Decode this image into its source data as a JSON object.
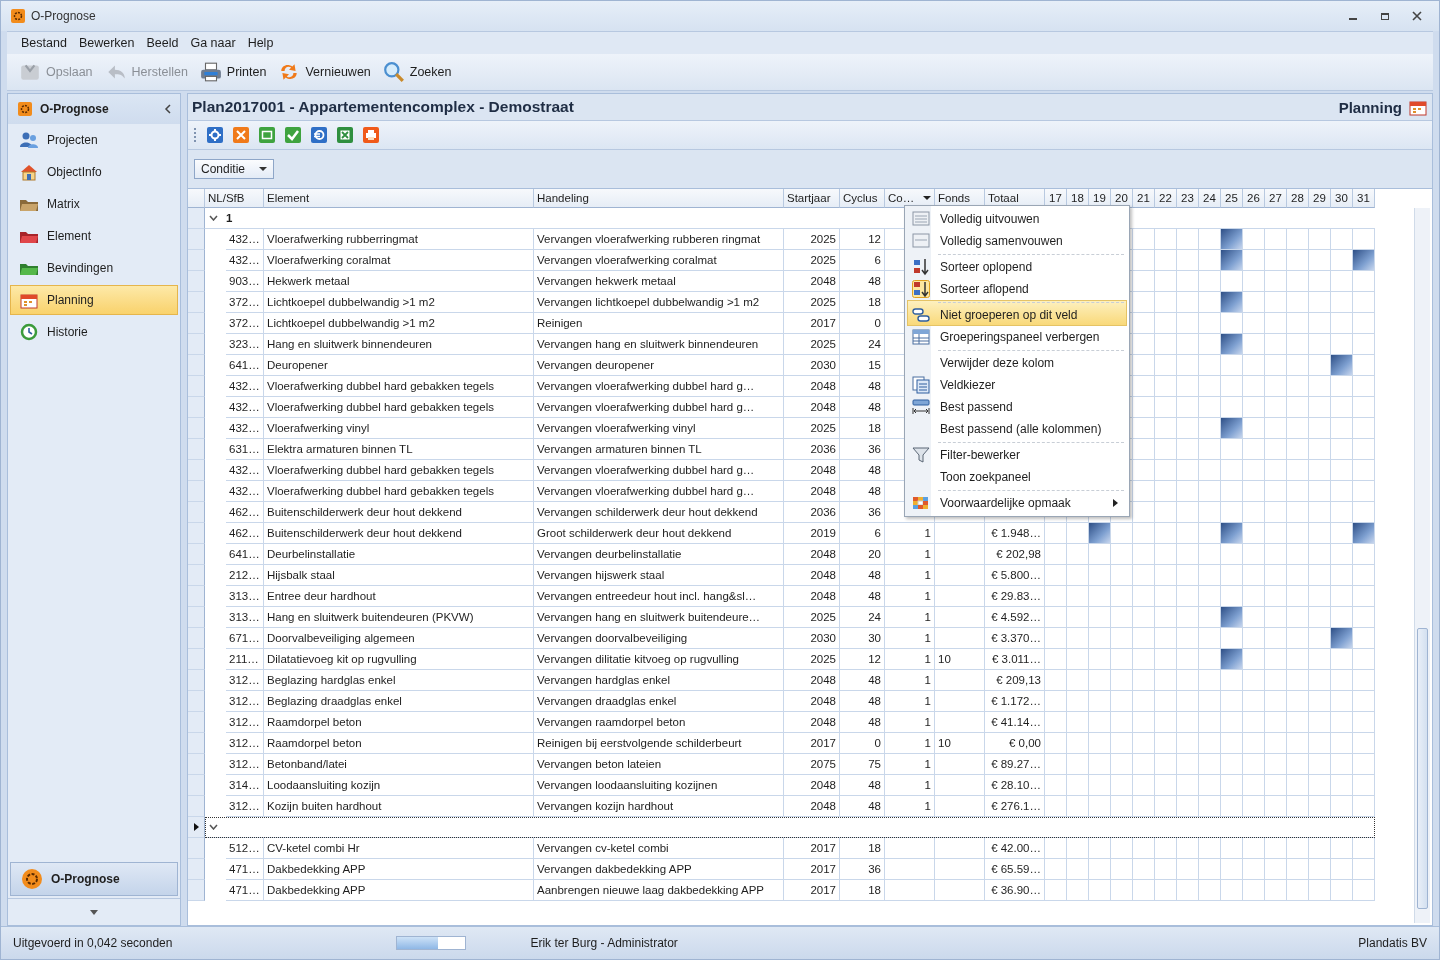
{
  "window": {
    "title": "O-Prognose"
  },
  "menu": [
    "Bestand",
    "Bewerken",
    "Beeld",
    "Ga naar",
    "Help"
  ],
  "toolbar": [
    {
      "label": "Opslaan",
      "disabled": true
    },
    {
      "label": "Herstellen",
      "disabled": true
    },
    {
      "label": "Printen",
      "disabled": false
    },
    {
      "label": "Vernieuwen",
      "disabled": false
    },
    {
      "label": "Zoeken",
      "disabled": false
    }
  ],
  "sidebar": {
    "title": "O-Prognose",
    "items": [
      {
        "label": "Projecten",
        "selected": false
      },
      {
        "label": "ObjectInfo",
        "selected": false
      },
      {
        "label": "Matrix",
        "selected": false
      },
      {
        "label": "Element",
        "selected": false
      },
      {
        "label": "Bevindingen",
        "selected": false
      },
      {
        "label": "Planning",
        "selected": true
      },
      {
        "label": "Historie",
        "selected": false
      }
    ],
    "footer": "O-Prognose"
  },
  "content": {
    "title": "Plan2017001 - Appartementencomplex - Demostraat",
    "section": "Planning"
  },
  "group_panel": {
    "field": "Conditie"
  },
  "table": {
    "columns": [
      "NL/SfB",
      "Element",
      "Handeling",
      "Startjaar",
      "Cyclus",
      "Co…",
      "Fonds",
      "Totaal"
    ],
    "timeline_columns": [
      "17",
      "18",
      "19",
      "20",
      "21",
      "22",
      "23",
      "24",
      "25",
      "26",
      "27",
      "28",
      "29",
      "30",
      "31"
    ],
    "groups": [
      {
        "label": "1",
        "expanded": true,
        "current": false,
        "rows": [
          {
            "code": "432…",
            "element": "Vloerafwerking rubberringmat",
            "action": "Vervangen vloerafwerking rubberen ringmat",
            "start": "2025",
            "cycle": "12",
            "timeline": [
              false,
              false,
              false,
              false,
              true,
              false,
              false,
              false,
              false,
              false,
              false
            ]
          },
          {
            "code": "432…",
            "element": "Vloerafwerking coralmat",
            "action": "Vervangen vloerafwerking coralmat",
            "start": "2025",
            "cycle": "6",
            "timeline": [
              false,
              false,
              false,
              false,
              true,
              false,
              false,
              false,
              false,
              false,
              true
            ]
          },
          {
            "code": "903…",
            "element": "Hekwerk metaal",
            "action": "Vervangen hekwerk metaal",
            "start": "2048",
            "cycle": "48",
            "timeline": [
              false,
              false,
              false,
              false,
              false,
              false,
              false,
              false,
              false,
              false,
              false
            ]
          },
          {
            "code": "372…",
            "element": "Lichtkoepel dubbelwandig >1 m2",
            "action": "Vervangen lichtkoepel dubbelwandig >1 m2",
            "start": "2025",
            "cycle": "18",
            "timeline": [
              false,
              false,
              false,
              false,
              true,
              false,
              false,
              false,
              false,
              false,
              false
            ]
          },
          {
            "code": "372…",
            "element": "Lichtkoepel dubbelwandig >1 m2",
            "action": "Reinigen",
            "start": "2017",
            "cycle": "0",
            "timeline": [
              false,
              false,
              false,
              false,
              false,
              false,
              false,
              false,
              false,
              false,
              false
            ]
          },
          {
            "code": "323…",
            "element": "Hang en sluitwerk binnendeuren",
            "action": "Vervangen hang en sluitwerk binnendeuren",
            "start": "2025",
            "cycle": "24",
            "timeline": [
              false,
              false,
              false,
              false,
              true,
              false,
              false,
              false,
              false,
              false,
              false
            ]
          },
          {
            "code": "641…",
            "element": "Deuropener",
            "action": "Vervangen deuropener",
            "start": "2030",
            "cycle": "15",
            "timeline": [
              false,
              false,
              false,
              false,
              false,
              false,
              false,
              false,
              false,
              true,
              false
            ]
          },
          {
            "code": "432…",
            "element": "Vloerafwerking dubbel hard gebakken tegels",
            "action": "Vervangen vloerafwerking dubbel hard g…",
            "start": "2048",
            "cycle": "48",
            "timeline": [
              false,
              false,
              false,
              false,
              false,
              false,
              false,
              false,
              false,
              false,
              false
            ]
          },
          {
            "code": "432…",
            "element": "Vloerafwerking dubbel hard gebakken tegels",
            "action": "Vervangen vloerafwerking dubbel hard g…",
            "start": "2048",
            "cycle": "48",
            "timeline": [
              false,
              false,
              false,
              false,
              false,
              false,
              false,
              false,
              false,
              false,
              false
            ]
          },
          {
            "code": "432…",
            "element": "Vloerafwerking vinyl",
            "action": "Vervangen vloerafwerking vinyl",
            "start": "2025",
            "cycle": "18",
            "timeline": [
              false,
              false,
              false,
              false,
              true,
              false,
              false,
              false,
              false,
              false,
              false
            ]
          },
          {
            "code": "631…",
            "element": "Elektra armaturen binnen TL",
            "action": "Vervangen armaturen binnen TL",
            "start": "2036",
            "cycle": "36",
            "timeline": [
              false,
              false,
              false,
              false,
              false,
              false,
              false,
              false,
              false,
              false,
              false
            ]
          },
          {
            "code": "432…",
            "element": "Vloerafwerking dubbel hard gebakken tegels",
            "action": "Vervangen vloerafwerking dubbel hard g…",
            "start": "2048",
            "cycle": "48",
            "timeline": [
              false,
              false,
              false,
              false,
              false,
              false,
              false,
              false,
              false,
              false,
              false
            ]
          },
          {
            "code": "432…",
            "element": "Vloerafwerking dubbel hard gebakken tegels",
            "action": "Vervangen vloerafwerking dubbel hard g…",
            "start": "2048",
            "cycle": "48",
            "timeline": [
              false,
              false,
              false,
              false,
              false,
              false,
              false,
              false,
              false,
              false,
              false
            ]
          },
          {
            "code": "462…",
            "element": "Buitenschilderwerk deur hout dekkend",
            "action": "Vervangen schilderwerk deur hout dekkend",
            "start": "2036",
            "cycle": "36",
            "timeline": [
              false,
              false,
              false,
              false,
              false,
              false,
              false,
              false,
              false,
              false,
              false
            ]
          },
          {
            "code": "462…",
            "element": "Buitenschilderwerk deur hout dekkend",
            "action": "Groot schilderwerk deur hout dekkend",
            "start": "2019",
            "cycle": "6",
            "count": "1",
            "total": "€ 1.948…",
            "timeline": [
              false,
              false,
              true,
              false,
              false,
              false,
              false,
              false,
              true,
              false,
              false,
              false,
              false,
              false,
              true
            ]
          },
          {
            "code": "641…",
            "element": "Deurbelinstallatie",
            "action": "Vervangen deurbelinstallatie",
            "start": "2048",
            "cycle": "20",
            "count": "1",
            "total": "€ 202,98",
            "timeline": [
              false,
              false,
              false,
              false,
              false,
              false,
              false,
              false,
              false,
              false,
              false,
              false,
              false,
              false,
              false
            ]
          },
          {
            "code": "212…",
            "element": "Hijsbalk staal",
            "action": "Vervangen hijswerk staal",
            "start": "2048",
            "cycle": "48",
            "count": "1",
            "total": "€ 5.800…",
            "timeline": [
              false,
              false,
              false,
              false,
              false,
              false,
              false,
              false,
              false,
              false,
              false,
              false,
              false,
              false,
              false
            ]
          },
          {
            "code": "313…",
            "element": "Entree deur hardhout",
            "action": "Vervangen entreedeur hout incl. hang&sl…",
            "start": "2048",
            "cycle": "48",
            "count": "1",
            "total": "€ 29.83…",
            "timeline": [
              false,
              false,
              false,
              false,
              false,
              false,
              false,
              false,
              false,
              false,
              false,
              false,
              false,
              false,
              false
            ]
          },
          {
            "code": "313…",
            "element": "Hang en sluitwerk buitendeuren (PKVW)",
            "action": "Vervangen hang en sluitwerk buitendeure…",
            "start": "2025",
            "cycle": "24",
            "count": "1",
            "total": "€ 4.592…",
            "timeline": [
              false,
              false,
              false,
              false,
              false,
              false,
              false,
              false,
              true,
              false,
              false,
              false,
              false,
              false,
              false
            ]
          },
          {
            "code": "671…",
            "element": "Doorvalbeveiliging algemeen",
            "action": "Vervangen doorvalbeveiliging",
            "start": "2030",
            "cycle": "30",
            "count": "1",
            "total": "€ 3.370…",
            "timeline": [
              false,
              false,
              false,
              false,
              false,
              false,
              false,
              false,
              false,
              false,
              false,
              false,
              false,
              true,
              false
            ]
          },
          {
            "code": "211…",
            "element": "Dilatatievoeg kit op rugvulling",
            "action": "Vervangen dilitatie kitvoeg op rugvulling",
            "start": "2025",
            "cycle": "12",
            "count": "1",
            "fund": "10",
            "total": "€ 3.011…",
            "timeline": [
              false,
              false,
              false,
              false,
              false,
              false,
              false,
              false,
              true,
              false,
              false,
              false,
              false,
              false,
              false
            ]
          },
          {
            "code": "312…",
            "element": "Beglazing hardglas enkel",
            "action": "Vervangen hardglas enkel",
            "start": "2048",
            "cycle": "48",
            "count": "1",
            "total": "€ 209,13",
            "timeline": [
              false,
              false,
              false,
              false,
              false,
              false,
              false,
              false,
              false,
              false,
              false,
              false,
              false,
              false,
              false
            ]
          },
          {
            "code": "312…",
            "element": "Beglazing draadglas enkel",
            "action": "Vervangen draadglas enkel",
            "start": "2048",
            "cycle": "48",
            "count": "1",
            "total": "€ 1.172…",
            "timeline": [
              false,
              false,
              false,
              false,
              false,
              false,
              false,
              false,
              false,
              false,
              false,
              false,
              false,
              false,
              false
            ]
          },
          {
            "code": "312…",
            "element": "Raamdorpel beton",
            "action": "Vervangen raamdorpel beton",
            "start": "2048",
            "cycle": "48",
            "count": "1",
            "total": "€ 41.14…",
            "timeline": [
              false,
              false,
              false,
              false,
              false,
              false,
              false,
              false,
              false,
              false,
              false,
              false,
              false,
              false,
              false
            ]
          },
          {
            "code": "312…",
            "element": "Raamdorpel beton",
            "action": "Reinigen bij eerstvolgende schilderbeurt",
            "start": "2017",
            "cycle": "0",
            "count": "1",
            "fund": "10",
            "total": "€ 0,00",
            "timeline": [
              false,
              false,
              false,
              false,
              false,
              false,
              false,
              false,
              false,
              false,
              false,
              false,
              false,
              false,
              false
            ]
          },
          {
            "code": "312…",
            "element": "Betonband/latei",
            "action": "Vervangen beton lateien",
            "start": "2075",
            "cycle": "75",
            "count": "1",
            "total": "€ 89.27…",
            "timeline": [
              false,
              false,
              false,
              false,
              false,
              false,
              false,
              false,
              false,
              false,
              false,
              false,
              false,
              false,
              false
            ]
          },
          {
            "code": "314…",
            "element": "Loodaansluiting kozijn",
            "action": "Vervangen loodaansluiting kozijnen",
            "start": "2048",
            "cycle": "48",
            "count": "1",
            "total": "€ 28.10…",
            "timeline": [
              false,
              false,
              false,
              false,
              false,
              false,
              false,
              false,
              false,
              false,
              false,
              false,
              false,
              false,
              false
            ]
          },
          {
            "code": "312…",
            "element": "Kozijn buiten hardhout",
            "action": "Vervangen kozijn hardhout",
            "start": "2048",
            "cycle": "48",
            "count": "1",
            "total": "€ 276.1…",
            "timeline": [
              false,
              false,
              false,
              false,
              false,
              false,
              false,
              false,
              false,
              false,
              false,
              false,
              false,
              false,
              false
            ]
          }
        ]
      },
      {
        "expanded": true,
        "current": true,
        "rows": [
          {
            "code": "512…",
            "element": "CV-ketel combi Hr",
            "action": "Vervangen cv-ketel combi",
            "start": "2017",
            "cycle": "18",
            "total": "€ 42.00…",
            "timeline": [
              false,
              false,
              false,
              false,
              false,
              false,
              false,
              false,
              false,
              false,
              false,
              false,
              false,
              false,
              false
            ]
          },
          {
            "code": "471…",
            "element": "Dakbedekking APP",
            "action": "Vervangen dakbedekking APP",
            "start": "2017",
            "cycle": "36",
            "total": "€ 65.59…",
            "timeline": [
              false,
              false,
              false,
              false,
              false,
              false,
              false,
              false,
              false,
              false,
              false,
              false,
              false,
              false,
              false
            ]
          },
          {
            "code": "471…",
            "element": "Dakbedekking APP",
            "action": "Aanbrengen nieuwe laag dakbedekking APP",
            "start": "2017",
            "cycle": "18",
            "total": "€ 36.90…",
            "timeline": [
              false,
              false,
              false,
              false,
              false,
              false,
              false,
              false,
              false,
              false,
              false,
              false,
              false,
              false,
              false
            ]
          }
        ]
      }
    ]
  },
  "context_menu": [
    {
      "label": "Volledig uitvouwen",
      "separator_before": false,
      "highlighted": false,
      "submenu": false
    },
    {
      "label": "Volledig samenvouwen",
      "separator_before": false,
      "highlighted": false,
      "submenu": false
    },
    {
      "label": "Sorteer oplopend",
      "separator_before": true,
      "highlighted": false,
      "submenu": false
    },
    {
      "label": "Sorteer aflopend",
      "separator_before": false,
      "highlighted": false,
      "submenu": false
    },
    {
      "label": "Niet groeperen op dit veld",
      "separator_before": true,
      "highlighted": true,
      "submenu": false
    },
    {
      "label": "Groeperingspaneel verbergen",
      "separator_before": false,
      "highlighted": false,
      "submenu": false
    },
    {
      "label": "Verwijder deze kolom",
      "separator_before": true,
      "highlighted": false,
      "submenu": false
    },
    {
      "label": "Veldkiezer",
      "separator_before": false,
      "highlighted": false,
      "submenu": false
    },
    {
      "label": "Best passend",
      "separator_before": false,
      "highlighted": false,
      "submenu": false
    },
    {
      "label": "Best passend (alle kolommen)",
      "separator_before": false,
      "highlighted": false,
      "submenu": false
    },
    {
      "label": "Filter-bewerker",
      "separator_before": true,
      "highlighted": false,
      "submenu": false
    },
    {
      "label": "Toon zoekpaneel",
      "separator_before": false,
      "highlighted": false,
      "submenu": false
    },
    {
      "label": "Voorwaardelijke opmaak",
      "separator_before": true,
      "highlighted": false,
      "submenu": true
    }
  ],
  "status_bar": {
    "message": "Uitgevoerd in 0,042 seconden",
    "progress": {
      "level": 0.6
    },
    "user": "Erik ter Burg - Administrator",
    "company": "Plandatis BV"
  }
}
